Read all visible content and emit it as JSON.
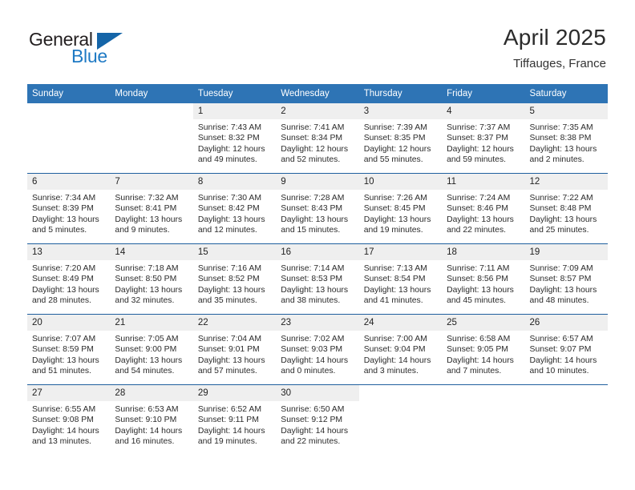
{
  "brand": {
    "name_part1": "General",
    "name_part2": "Blue",
    "logo_icon": "triangle-logo-icon"
  },
  "header": {
    "title": "April 2025",
    "location": "Tiffauges, France"
  },
  "calendar": {
    "weekday_headers": [
      "Sunday",
      "Monday",
      "Tuesday",
      "Wednesday",
      "Thursday",
      "Friday",
      "Saturday"
    ],
    "colors": {
      "header_blue": "#2e74b5",
      "row_divider_blue": "#1f5f9e",
      "daynum_band": "#efefef",
      "brand_blue": "#1f7ac4",
      "brand_dark": "#231f20"
    },
    "weeks": [
      [
        {
          "day": "",
          "lines": []
        },
        {
          "day": "",
          "lines": []
        },
        {
          "day": "1",
          "lines": [
            "Sunrise: 7:43 AM",
            "Sunset: 8:32 PM",
            "Daylight: 12 hours",
            "and 49 minutes."
          ]
        },
        {
          "day": "2",
          "lines": [
            "Sunrise: 7:41 AM",
            "Sunset: 8:34 PM",
            "Daylight: 12 hours",
            "and 52 minutes."
          ]
        },
        {
          "day": "3",
          "lines": [
            "Sunrise: 7:39 AM",
            "Sunset: 8:35 PM",
            "Daylight: 12 hours",
            "and 55 minutes."
          ]
        },
        {
          "day": "4",
          "lines": [
            "Sunrise: 7:37 AM",
            "Sunset: 8:37 PM",
            "Daylight: 12 hours",
            "and 59 minutes."
          ]
        },
        {
          "day": "5",
          "lines": [
            "Sunrise: 7:35 AM",
            "Sunset: 8:38 PM",
            "Daylight: 13 hours",
            "and 2 minutes."
          ]
        }
      ],
      [
        {
          "day": "6",
          "lines": [
            "Sunrise: 7:34 AM",
            "Sunset: 8:39 PM",
            "Daylight: 13 hours",
            "and 5 minutes."
          ]
        },
        {
          "day": "7",
          "lines": [
            "Sunrise: 7:32 AM",
            "Sunset: 8:41 PM",
            "Daylight: 13 hours",
            "and 9 minutes."
          ]
        },
        {
          "day": "8",
          "lines": [
            "Sunrise: 7:30 AM",
            "Sunset: 8:42 PM",
            "Daylight: 13 hours",
            "and 12 minutes."
          ]
        },
        {
          "day": "9",
          "lines": [
            "Sunrise: 7:28 AM",
            "Sunset: 8:43 PM",
            "Daylight: 13 hours",
            "and 15 minutes."
          ]
        },
        {
          "day": "10",
          "lines": [
            "Sunrise: 7:26 AM",
            "Sunset: 8:45 PM",
            "Daylight: 13 hours",
            "and 19 minutes."
          ]
        },
        {
          "day": "11",
          "lines": [
            "Sunrise: 7:24 AM",
            "Sunset: 8:46 PM",
            "Daylight: 13 hours",
            "and 22 minutes."
          ]
        },
        {
          "day": "12",
          "lines": [
            "Sunrise: 7:22 AM",
            "Sunset: 8:48 PM",
            "Daylight: 13 hours",
            "and 25 minutes."
          ]
        }
      ],
      [
        {
          "day": "13",
          "lines": [
            "Sunrise: 7:20 AM",
            "Sunset: 8:49 PM",
            "Daylight: 13 hours",
            "and 28 minutes."
          ]
        },
        {
          "day": "14",
          "lines": [
            "Sunrise: 7:18 AM",
            "Sunset: 8:50 PM",
            "Daylight: 13 hours",
            "and 32 minutes."
          ]
        },
        {
          "day": "15",
          "lines": [
            "Sunrise: 7:16 AM",
            "Sunset: 8:52 PM",
            "Daylight: 13 hours",
            "and 35 minutes."
          ]
        },
        {
          "day": "16",
          "lines": [
            "Sunrise: 7:14 AM",
            "Sunset: 8:53 PM",
            "Daylight: 13 hours",
            "and 38 minutes."
          ]
        },
        {
          "day": "17",
          "lines": [
            "Sunrise: 7:13 AM",
            "Sunset: 8:54 PM",
            "Daylight: 13 hours",
            "and 41 minutes."
          ]
        },
        {
          "day": "18",
          "lines": [
            "Sunrise: 7:11 AM",
            "Sunset: 8:56 PM",
            "Daylight: 13 hours",
            "and 45 minutes."
          ]
        },
        {
          "day": "19",
          "lines": [
            "Sunrise: 7:09 AM",
            "Sunset: 8:57 PM",
            "Daylight: 13 hours",
            "and 48 minutes."
          ]
        }
      ],
      [
        {
          "day": "20",
          "lines": [
            "Sunrise: 7:07 AM",
            "Sunset: 8:59 PM",
            "Daylight: 13 hours",
            "and 51 minutes."
          ]
        },
        {
          "day": "21",
          "lines": [
            "Sunrise: 7:05 AM",
            "Sunset: 9:00 PM",
            "Daylight: 13 hours",
            "and 54 minutes."
          ]
        },
        {
          "day": "22",
          "lines": [
            "Sunrise: 7:04 AM",
            "Sunset: 9:01 PM",
            "Daylight: 13 hours",
            "and 57 minutes."
          ]
        },
        {
          "day": "23",
          "lines": [
            "Sunrise: 7:02 AM",
            "Sunset: 9:03 PM",
            "Daylight: 14 hours",
            "and 0 minutes."
          ]
        },
        {
          "day": "24",
          "lines": [
            "Sunrise: 7:00 AM",
            "Sunset: 9:04 PM",
            "Daylight: 14 hours",
            "and 3 minutes."
          ]
        },
        {
          "day": "25",
          "lines": [
            "Sunrise: 6:58 AM",
            "Sunset: 9:05 PM",
            "Daylight: 14 hours",
            "and 7 minutes."
          ]
        },
        {
          "day": "26",
          "lines": [
            "Sunrise: 6:57 AM",
            "Sunset: 9:07 PM",
            "Daylight: 14 hours",
            "and 10 minutes."
          ]
        }
      ],
      [
        {
          "day": "27",
          "lines": [
            "Sunrise: 6:55 AM",
            "Sunset: 9:08 PM",
            "Daylight: 14 hours",
            "and 13 minutes."
          ]
        },
        {
          "day": "28",
          "lines": [
            "Sunrise: 6:53 AM",
            "Sunset: 9:10 PM",
            "Daylight: 14 hours",
            "and 16 minutes."
          ]
        },
        {
          "day": "29",
          "lines": [
            "Sunrise: 6:52 AM",
            "Sunset: 9:11 PM",
            "Daylight: 14 hours",
            "and 19 minutes."
          ]
        },
        {
          "day": "30",
          "lines": [
            "Sunrise: 6:50 AM",
            "Sunset: 9:12 PM",
            "Daylight: 14 hours",
            "and 22 minutes."
          ]
        },
        {
          "day": "",
          "lines": []
        },
        {
          "day": "",
          "lines": []
        },
        {
          "day": "",
          "lines": []
        }
      ]
    ]
  }
}
